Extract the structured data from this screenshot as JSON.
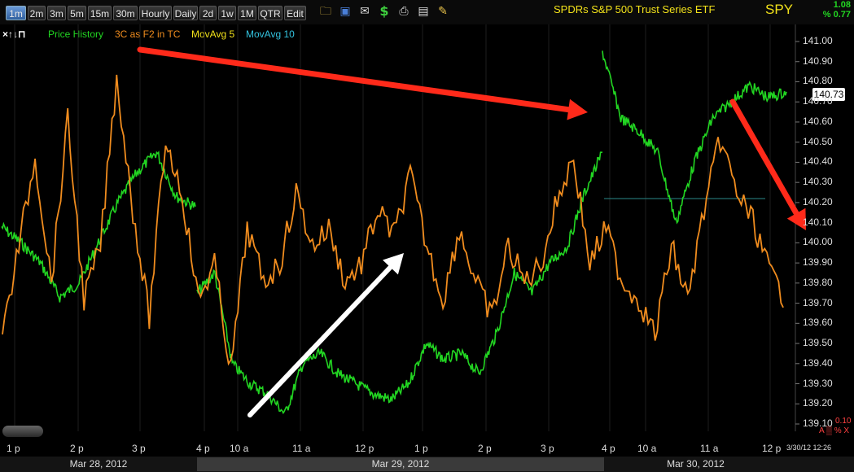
{
  "toolbar": {
    "timeframes": [
      "1m",
      "2m",
      "3m",
      "5m",
      "15m",
      "30m",
      "Hourly",
      "Daily",
      "2d",
      "1w",
      "1M",
      "QTR",
      "Edit"
    ],
    "active": "1m",
    "icons": [
      "folder-icon",
      "save-icon",
      "mail-icon",
      "dollar-icon",
      "print-icon",
      "keyboard-icon",
      "pencil-icon"
    ]
  },
  "header": {
    "title": "SPDRs S&P 500 Trust Series ETF",
    "symbol": "SPY",
    "change": "1.08",
    "change_pct": "% 0.77"
  },
  "legend": {
    "controls": "×↑↓⊓",
    "items": [
      {
        "label": "Price History",
        "color": "#22d622"
      },
      {
        "label": "3C as F2 in TC",
        "color": "#f08c1e"
      },
      {
        "label": "MovAvg 5",
        "color": "#f2e21a"
      },
      {
        "label": "MovAvg 10",
        "color": "#33c4e0"
      }
    ]
  },
  "price_tag": "140.73",
  "bottom": {
    "value": "0.10",
    "controls": "A ▒ % X",
    "timestamp": "3/30/12 12:26"
  },
  "chart_data": {
    "type": "line",
    "ylim": [
      139.05,
      141.1
    ],
    "y_ticks": [
      "141.00",
      "140.90",
      "140.80",
      "140.70",
      "140.60",
      "140.50",
      "140.40",
      "140.30",
      "140.20",
      "140.10",
      "140.00",
      "139.90",
      "139.80",
      "139.70",
      "139.60",
      "139.50",
      "139.40",
      "139.30",
      "139.20",
      "139.10"
    ],
    "x_ticks": [
      "1 p",
      "2 p",
      "3 p",
      "4 p",
      "10 a",
      "11 a",
      "12 p",
      "1 p",
      "2 p",
      "3 p",
      "4 p",
      "10 a",
      "11 a",
      "12 p"
    ],
    "dates": [
      "Mar 28, 2012",
      "Mar 29, 2012",
      "Mar 30, 2012"
    ],
    "series": [
      {
        "name": "Price History",
        "color": "#22d622",
        "values": [
          140.08,
          140.0,
          139.9,
          139.73,
          139.8,
          140.0,
          140.2,
          140.35,
          140.45,
          140.23,
          140.18,
          139.75,
          139.85,
          139.4,
          139.3,
          139.25,
          139.15,
          139.4,
          139.45,
          139.35,
          139.3,
          139.25,
          139.22,
          139.3,
          139.5,
          139.42,
          139.45,
          139.35,
          139.55,
          139.85,
          139.75,
          139.9,
          139.98,
          140.25,
          140.45,
          140.95,
          140.62,
          140.55,
          140.45,
          140.1,
          140.4,
          140.62,
          140.7,
          140.78,
          140.72,
          140.75
        ]
      },
      {
        "name": "3C as F2 in TC",
        "color": "#f08c1e",
        "values": [
          0.2,
          0.45,
          0.7,
          0.35,
          0.8,
          0.3,
          0.45,
          0.92,
          0.55,
          0.25,
          0.75,
          0.6,
          0.3,
          0.4,
          0.1,
          0.5,
          0.35,
          0.4,
          0.6,
          0.45,
          0.5,
          0.35,
          0.4,
          0.55,
          0.48,
          0.65,
          0.45,
          0.3,
          0.5,
          0.35,
          0.25,
          0.45,
          0.35,
          0.4,
          0.58,
          0.7,
          0.4,
          0.5,
          0.35,
          0.3,
          0.2,
          0.45,
          0.3,
          0.55,
          0.75,
          0.6,
          0.52,
          0.38,
          0.3
        ]
      }
    ],
    "horizontal_line": 140.22,
    "arrows": [
      {
        "color": "#ff2a1a",
        "from": [
          "Mar 28 3 p",
          0.93
        ],
        "to": [
          "Mar 30 4 p",
          0.68
        ]
      },
      {
        "color": "#ffffff",
        "from": [
          "Mar 29 11 a",
          139.1
        ],
        "to": [
          "Mar 29 1 p",
          139.85
        ]
      },
      {
        "color": "#ff2a1a",
        "from": [
          "Mar 30 11 a",
          140.72
        ],
        "to": [
          "Mar 30 12 p",
          139.97
        ]
      }
    ]
  }
}
